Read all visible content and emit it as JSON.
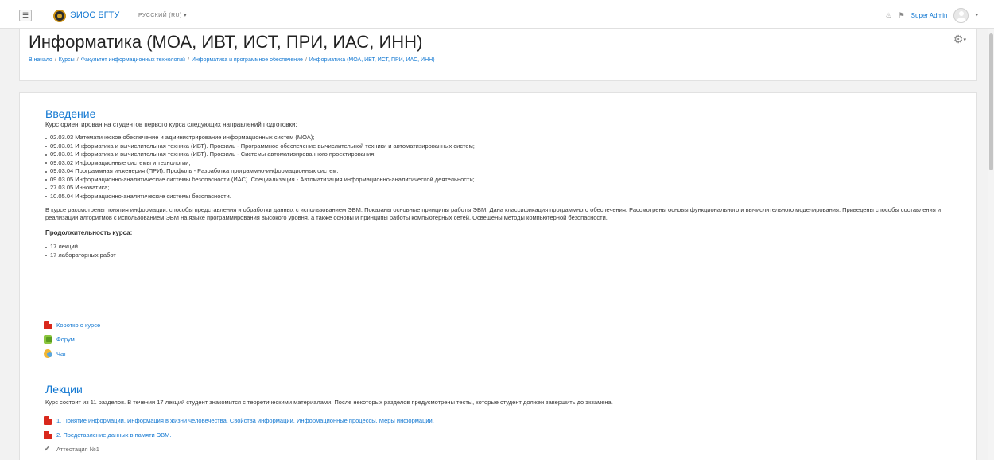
{
  "navbar": {
    "menu_toggle": "☰",
    "site_name": "ЭИОС БГТУ",
    "language": "РУССКИЙ (RU)",
    "user_name": "Super Admin"
  },
  "header": {
    "title": "Информатика (МОА, ИВТ, ИСТ, ПРИ, ИАС, ИНН)",
    "breadcrumb": [
      "В начало",
      "Курсы",
      "Факультет информационных технологий",
      "Информатика и программное обеспечение",
      "Информатика (МОА, ИВТ, ИСТ, ПРИ, ИАС, ИНН)"
    ]
  },
  "intro": {
    "title": "Введение",
    "lead": "Курс ориентирован на студентов первого курса следующих направлений подготовки:",
    "programs": [
      "02.03.03 Математическое обеспечение и администрирование информационных систем (МОА);",
      "09.03.01 Информатика и вычислительная техника (ИВТ). Профиль - Программное обеспечение вычислительной техники и автоматизированных систем;",
      "09.03.01 Информатика и вычислительная техника (ИВТ). Профиль - Системы автоматизированного проектирования;",
      "09.03.02 Информационные системы и технологии;",
      "09.03.04 Программная инженерия (ПРИ). Профиль - Разработка программно-информационных систем;",
      "09.03.05 Информационно-аналитические системы безопасности (ИАС). Специализация - Автоматизация информационно-аналитической деятельности;",
      "27.03.05 Инноватика;",
      "10.05.04 Информационно-аналитические системы безопасности."
    ],
    "description": "В курсе рассмотрены понятия информации, способы представления и обработки данных с использованием ЭВМ. Показаны основные принципы работы ЭВМ. Дана классификация программного обеспечения. Рассмотрены основы функционального и вычислительного моделирования. Приведены способы составления и реализации алгоритмов с использованием ЭВМ на языке программирования высокого уровня, а также основы и принципы работы компьютерных сетей. Освещены методы компьютерной безопасности.",
    "duration_label": "Продолжительность курса:",
    "duration_items": [
      "17 лекций",
      "17 лабораторных работ"
    ],
    "activities": [
      "Коротко о курсе",
      "Форум",
      "Чат"
    ]
  },
  "lectures": {
    "title": "Лекции",
    "description": "Курс состоит из 11 разделов. В течении 17 лекций студент знакомится с теоретическими материалами. После некоторых разделов предусмотрены тесты, которые студент должен завершить до экзамена.",
    "items": [
      "1. Понятие информации. Информация в жизни человечества. Свойства информации. Информационные процессы. Меры информации.",
      "2. Представление данных в памяти ЭВМ.",
      "Аттестация №1"
    ]
  }
}
